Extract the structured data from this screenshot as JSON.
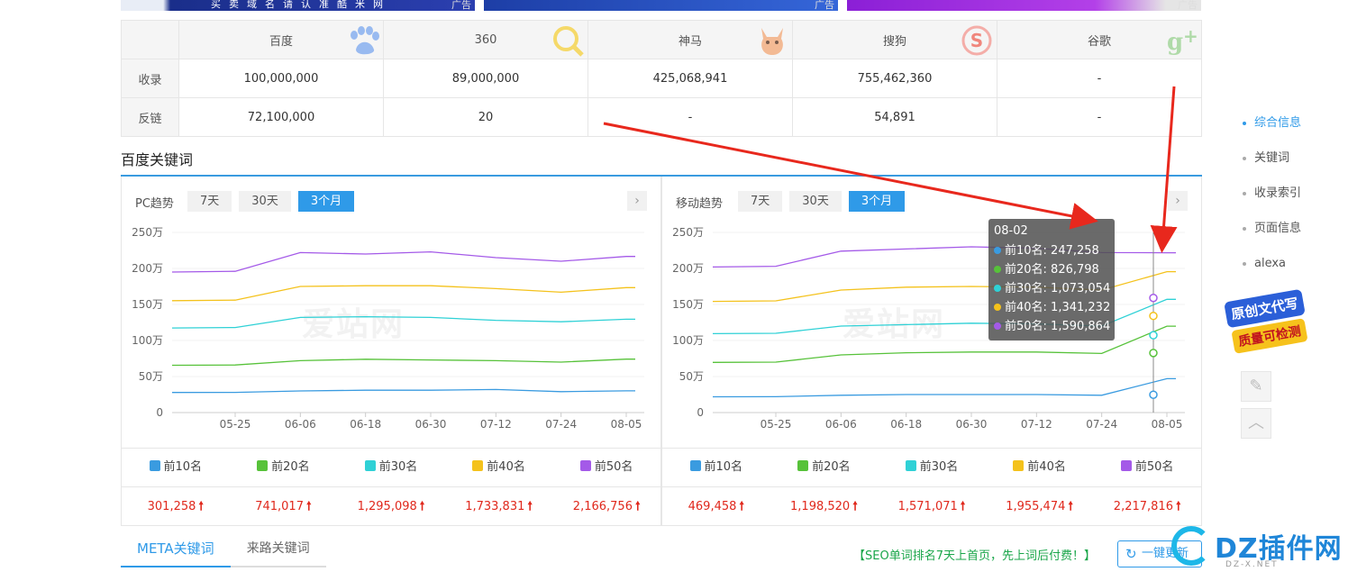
{
  "ads": {
    "ad1_text": "买卖域名请认准酷米网",
    "ad_tag": "广告"
  },
  "engines": {
    "headers": [
      "百度",
      "360",
      "神马",
      "搜狗",
      "谷歌"
    ],
    "icons": [
      "baidu-paw-icon",
      "360-search-icon",
      "shenma-alpaca-icon",
      "sogou-s-icon",
      "google-plus-icon"
    ],
    "rows": [
      {
        "label": "收录",
        "values": [
          "100,000,000",
          "89,000,000",
          "425,068,941",
          "755,462,360",
          "-"
        ]
      },
      {
        "label": "反链",
        "values": [
          "72,100,000",
          "20",
          "-",
          "54,891",
          "-"
        ]
      }
    ]
  },
  "section_title": "百度关键词",
  "watermark": "爱站网",
  "pc": {
    "title": "PC趋势",
    "tabs": [
      "7天",
      "30天",
      "3个月"
    ],
    "active_tab": "3个月",
    "values": [
      "301,258",
      "741,017",
      "1,295,098",
      "1,733,831",
      "2,166,756"
    ]
  },
  "mobile": {
    "title": "移动趋势",
    "tabs": [
      "7天",
      "30天",
      "3个月"
    ],
    "active_tab": "3个月",
    "values": [
      "469,458",
      "1,198,520",
      "1,571,071",
      "1,955,474",
      "2,217,816"
    ]
  },
  "legend": [
    "前10名",
    "前20名",
    "前30名",
    "前40名",
    "前50名"
  ],
  "colors": [
    "#3a9be0",
    "#57c23a",
    "#2fd1d6",
    "#f4c21c",
    "#a45ae8"
  ],
  "tooltip": {
    "title": "08-02",
    "rows": [
      "前10名: 247,258",
      "前20名: 826,798",
      "前30名: 1,073,054",
      "前40名: 1,341,232",
      "前50名: 1,590,864"
    ]
  },
  "chart_data": [
    {
      "type": "line",
      "title": "PC趋势",
      "x": [
        "05-25",
        "06-06",
        "06-18",
        "06-30",
        "07-12",
        "07-24",
        "08-05"
      ],
      "yticks": [
        "0",
        "50万",
        "100万",
        "150万",
        "200万",
        "250万"
      ],
      "ylim": [
        0,
        2500000
      ],
      "series": [
        {
          "name": "前10名",
          "values": [
            280000,
            300000,
            310000,
            310000,
            320000,
            290000,
            301258
          ]
        },
        {
          "name": "前20名",
          "values": [
            660000,
            720000,
            740000,
            730000,
            720000,
            700000,
            741017
          ]
        },
        {
          "name": "前30名",
          "values": [
            1180000,
            1320000,
            1330000,
            1320000,
            1280000,
            1260000,
            1295098
          ]
        },
        {
          "name": "前40名",
          "values": [
            1560000,
            1750000,
            1760000,
            1760000,
            1720000,
            1670000,
            1733831
          ]
        },
        {
          "name": "前50名",
          "values": [
            1960000,
            2220000,
            2200000,
            2230000,
            2150000,
            2100000,
            2166756
          ]
        }
      ]
    },
    {
      "type": "line",
      "title": "移动趋势",
      "x": [
        "05-25",
        "06-06",
        "06-18",
        "06-30",
        "07-12",
        "07-24",
        "08-05"
      ],
      "yticks": [
        "0",
        "50万",
        "100万",
        "150万",
        "200万",
        "250万"
      ],
      "ylim": [
        0,
        2500000
      ],
      "series": [
        {
          "name": "前10名",
          "values": [
            220000,
            240000,
            250000,
            250000,
            250000,
            240000,
            469458
          ]
        },
        {
          "name": "前20名",
          "values": [
            700000,
            800000,
            830000,
            840000,
            840000,
            820000,
            1198520
          ]
        },
        {
          "name": "前30名",
          "values": [
            1100000,
            1200000,
            1220000,
            1240000,
            1230000,
            1200000,
            1571071
          ]
        },
        {
          "name": "前40名",
          "values": [
            1550000,
            1700000,
            1740000,
            1750000,
            1740000,
            1700000,
            1955474
          ]
        },
        {
          "name": "前50名",
          "values": [
            2030000,
            2240000,
            2270000,
            2300000,
            2280000,
            2220000,
            2217816
          ]
        }
      ]
    }
  ],
  "sidenav": [
    "综合信息",
    "关键词",
    "收录索引",
    "页面信息",
    "alexa"
  ],
  "promo": {
    "line1": "原创文代写",
    "line2": "质量可检测"
  },
  "bottom_tabs": [
    "META关键词",
    "来路关键词"
  ],
  "seo_note": "【SEO单词排名7天上首页，先上词后付费！】",
  "refresh_label": "一键更新",
  "dz_logo": {
    "name": "DZ插件网",
    "sub": "DZ-X.NET"
  }
}
